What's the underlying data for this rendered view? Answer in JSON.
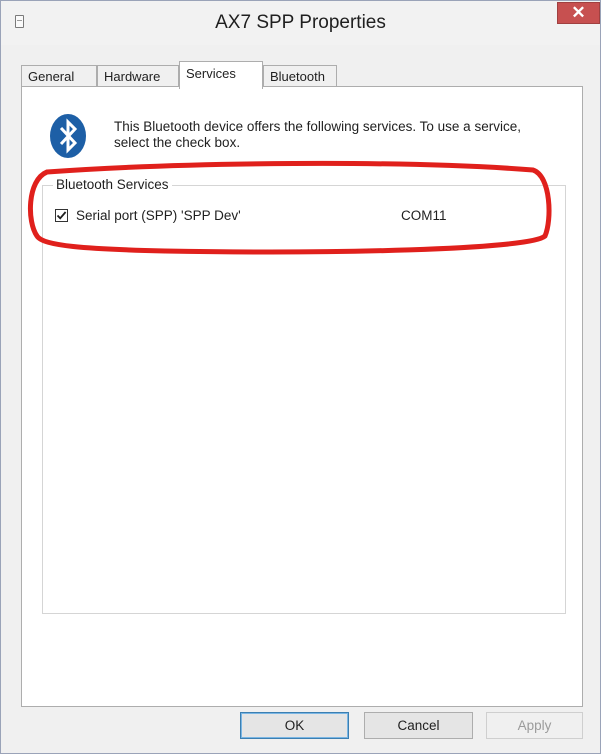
{
  "window": {
    "title": "AX7 SPP Properties",
    "close_glyph": "✕"
  },
  "tabs": [
    {
      "label": "General"
    },
    {
      "label": "Hardware"
    },
    {
      "label": "Services",
      "active": true
    },
    {
      "label": "Bluetooth"
    }
  ],
  "services": {
    "description": "This Bluetooth device offers the following services. To use a service, select the check box.",
    "group_label": "Bluetooth Services",
    "items": [
      {
        "checked": true,
        "name": "Serial port (SPP) 'SPP Dev'",
        "port": "COM11"
      }
    ]
  },
  "buttons": {
    "ok": "OK",
    "cancel": "Cancel",
    "apply": "Apply"
  },
  "colors": {
    "accent": "#1d5fa6",
    "close": "#c75050",
    "highlight": "#e0201c"
  },
  "icons": {
    "app": "device-icon",
    "bluetooth": "bluetooth-icon",
    "check": "checkmark-icon"
  }
}
